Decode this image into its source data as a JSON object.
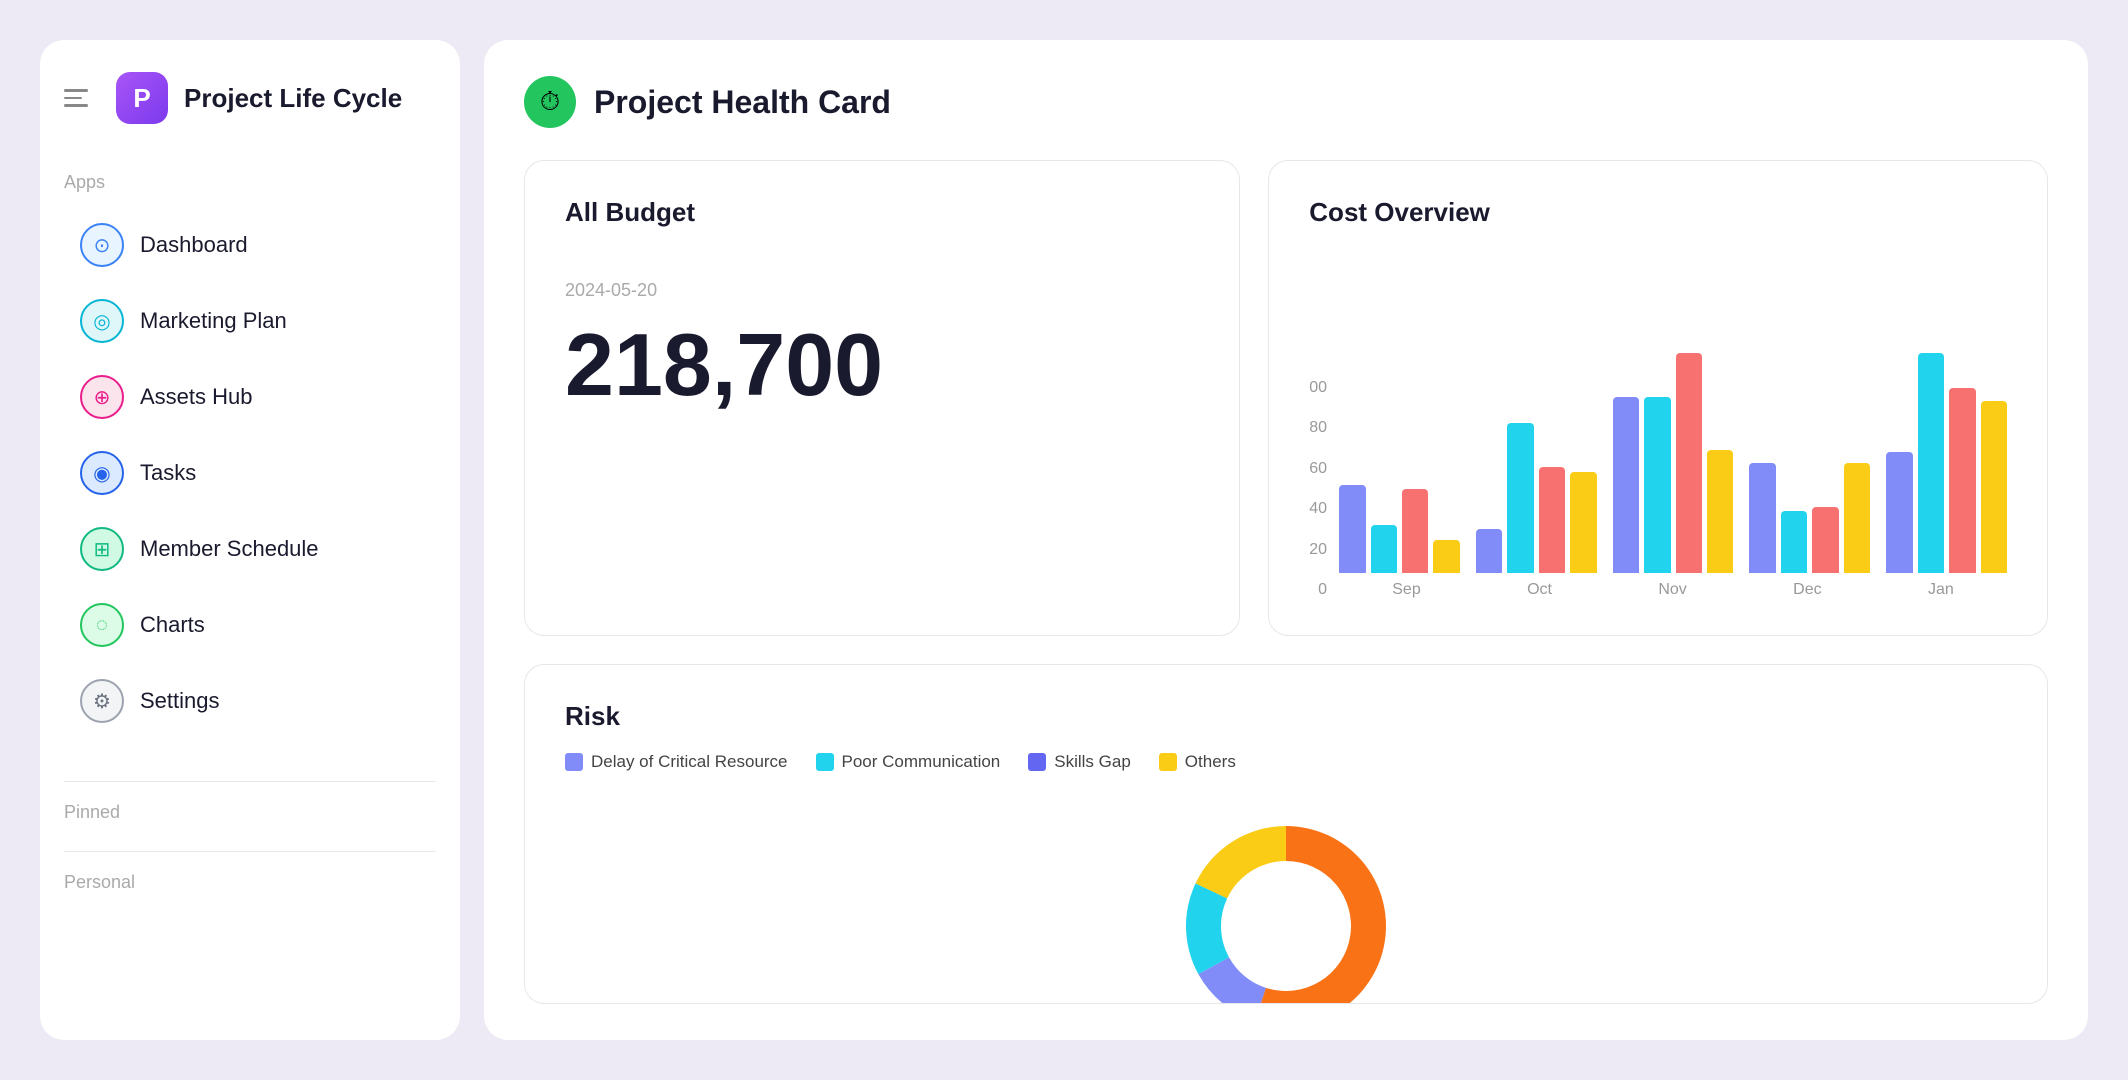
{
  "sidebar": {
    "project_logo_letter": "P",
    "project_name": "Project Life Cycle",
    "sections": {
      "apps_label": "Apps",
      "pinned_label": "Pinned",
      "personal_label": "Personal"
    },
    "nav_items": [
      {
        "id": "dashboard",
        "label": "Dashboard",
        "icon_type": "blue-outline",
        "icon_symbol": "⊙"
      },
      {
        "id": "marketing-plan",
        "label": "Marketing Plan",
        "icon_type": "cyan",
        "icon_symbol": "◎"
      },
      {
        "id": "assets-hub",
        "label": "Assets Hub",
        "icon_type": "pink",
        "icon_symbol": "⊕"
      },
      {
        "id": "tasks",
        "label": "Tasks",
        "icon_type": "blue-solid",
        "icon_symbol": "◉"
      },
      {
        "id": "member-schedule",
        "label": "Member Schedule",
        "icon_type": "green-grid",
        "icon_symbol": "⊞"
      },
      {
        "id": "charts",
        "label": "Charts",
        "icon_type": "green-circle",
        "icon_symbol": "◌"
      },
      {
        "id": "settings",
        "label": "Settings",
        "icon_type": "gray",
        "icon_symbol": "⚙"
      }
    ]
  },
  "main": {
    "header": {
      "icon_symbol": "⏱",
      "title": "Project Health Card"
    },
    "budget_card": {
      "title": "All Budget",
      "date": "2024-05-20",
      "amount": "218,700"
    },
    "cost_card": {
      "title": "Cost Overview",
      "y_labels": [
        "00",
        "80",
        "60",
        "40",
        "20",
        "0"
      ],
      "x_labels": [
        "Sep",
        "Oct",
        "Nov",
        "Dec",
        "Jan"
      ],
      "bar_groups": [
        {
          "month": "Sep",
          "bars": [
            {
              "color": "purple",
              "height_pct": 40
            },
            {
              "color": "cyan",
              "height_pct": 22
            },
            {
              "color": "red",
              "height_pct": 38
            },
            {
              "color": "yellow",
              "height_pct": 15
            }
          ]
        },
        {
          "month": "Oct",
          "bars": [
            {
              "color": "purple",
              "height_pct": 20
            },
            {
              "color": "cyan",
              "height_pct": 68
            },
            {
              "color": "red",
              "height_pct": 48
            },
            {
              "color": "yellow",
              "height_pct": 46
            }
          ]
        },
        {
          "month": "Nov",
          "bars": [
            {
              "color": "purple",
              "height_pct": 80
            },
            {
              "color": "cyan",
              "height_pct": 80
            },
            {
              "color": "red",
              "height_pct": 100
            },
            {
              "color": "yellow",
              "height_pct": 56
            }
          ]
        },
        {
          "month": "Dec",
          "bars": [
            {
              "color": "purple",
              "height_pct": 50
            },
            {
              "color": "cyan",
              "height_pct": 28
            },
            {
              "color": "red",
              "height_pct": 30
            },
            {
              "color": "yellow",
              "height_pct": 50
            }
          ]
        },
        {
          "month": "Jan",
          "bars": [
            {
              "color": "purple",
              "height_pct": 55
            },
            {
              "color": "cyan",
              "height_pct": 100
            },
            {
              "color": "red",
              "height_pct": 84
            },
            {
              "color": "yellow",
              "height_pct": 78
            }
          ]
        }
      ]
    },
    "risk_section": {
      "title": "Risk",
      "legend": [
        {
          "id": "delay",
          "label": "Delay of Critical Resource",
          "color": "#818cf8"
        },
        {
          "id": "poor-comm",
          "label": "Poor Communication",
          "color": "#22d3ee"
        },
        {
          "id": "skills-gap",
          "label": "Skills Gap",
          "color": "#6366f1"
        },
        {
          "id": "others",
          "label": "Others",
          "color": "#facc15"
        }
      ],
      "donut": {
        "segments": [
          {
            "color": "#f97316",
            "pct": 55
          },
          {
            "color": "#818cf8",
            "pct": 12
          },
          {
            "color": "#22d3ee",
            "pct": 15
          },
          {
            "color": "#facc15",
            "pct": 18
          }
        ]
      }
    }
  }
}
